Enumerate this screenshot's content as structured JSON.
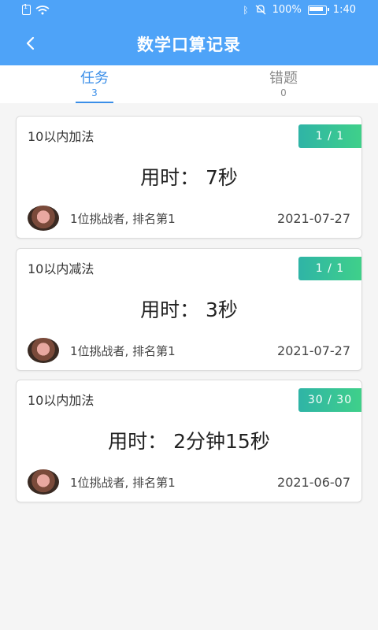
{
  "status_bar": {
    "battery_percent": "100%",
    "time": "1:40"
  },
  "header": {
    "title": "数学口算记录"
  },
  "tabs": [
    {
      "label": "任务",
      "count": "3"
    },
    {
      "label": "错题",
      "count": "0"
    }
  ],
  "cards": [
    {
      "title": "10以内加法",
      "badge": "1 / 1",
      "time": "用时：  7秒",
      "challenger": "1位挑战者, 排名第1",
      "date": "2021-07-27"
    },
    {
      "title": "10以内减法",
      "badge": "1 / 1",
      "time": "用时：  3秒",
      "challenger": "1位挑战者, 排名第1",
      "date": "2021-07-27"
    },
    {
      "title": "10以内加法",
      "badge": "30 / 30",
      "time": "用时：  2分钟15秒",
      "challenger": "1位挑战者, 排名第1",
      "date": "2021-06-07"
    }
  ],
  "colors": {
    "header_bg": "#4ea3f8",
    "tab_active": "#3a8ee8",
    "badge_start": "#2fb4a6",
    "badge_end": "#3fd08a"
  }
}
